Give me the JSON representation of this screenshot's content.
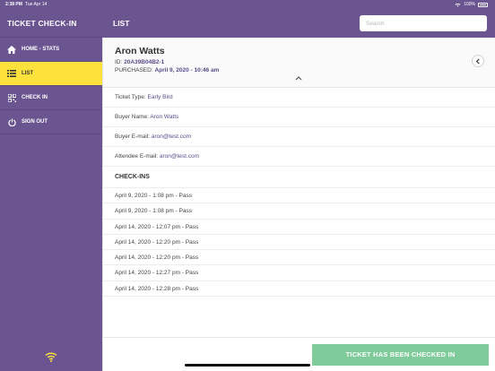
{
  "status_bar": {
    "time": "2:38 PM",
    "date": "Tue Apr 14",
    "battery": "100%"
  },
  "sidebar": {
    "brand": "TICKET CHECK-IN",
    "items": [
      {
        "label": "HOME - STATS",
        "icon": "home-icon",
        "active": false
      },
      {
        "label": "LIST",
        "icon": "list-icon",
        "active": true
      },
      {
        "label": "CHECK IN",
        "icon": "qr-icon",
        "active": false
      },
      {
        "label": "SIGN OUT",
        "icon": "power-icon",
        "active": false
      }
    ]
  },
  "topbar": {
    "title": "LIST",
    "search_placeholder": "Search"
  },
  "detail": {
    "buyer_name": "Aron Watts",
    "id_label": "ID:",
    "id_value": "20A39B04B2-1",
    "purchased_label": "PURCHASED:",
    "purchased_value": "April 9, 2020 - 10:46 am",
    "rows": [
      {
        "label": "Ticket Type:",
        "value": "Early Bird"
      },
      {
        "label": "Buyer Name:",
        "value": "Aron Watts"
      },
      {
        "label": "Buyer E-mail:",
        "value": "aron@test.com"
      },
      {
        "label": "Attendee E-mail:",
        "value": "aron@test.com"
      }
    ],
    "checkins_title": "CHECK-INS",
    "checkins": [
      "April 9, 2020 - 1:08 pm - Pass",
      "April 9, 2020 - 1:08 pm - Pass",
      "April 14, 2020 - 12:07 pm - Pass",
      "April 14, 2020 - 12:20 pm - Pass",
      "April 14, 2020 - 12:20 pm - Pass",
      "April 14, 2020 - 12:27 pm - Pass",
      "April 14, 2020 - 12:28 pm - Pass"
    ]
  },
  "footer": {
    "status_button": "TICKET HAS BEEN CHECKED IN"
  },
  "colors": {
    "purple": "#6a5590",
    "active_yellow": "#fde13c",
    "success_green": "#7fcc9a",
    "link_purple": "#5b4b8a"
  }
}
